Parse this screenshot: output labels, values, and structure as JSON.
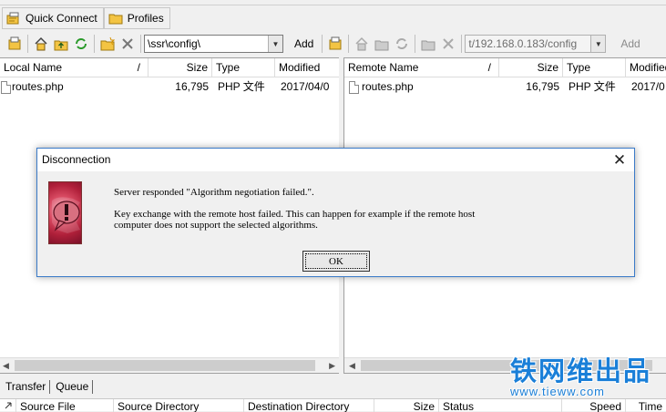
{
  "quickbar": {
    "quick_connect": "Quick Connect",
    "profiles": "Profiles"
  },
  "local_toolbar": {
    "path": "\\ssr\\config\\",
    "add_label": "Add"
  },
  "remote_toolbar": {
    "path": "t/192.168.0.183/config",
    "add_label": "Add"
  },
  "local_pane": {
    "columns": [
      "Local Name",
      "/",
      "Size",
      "Type",
      "Modified"
    ],
    "rows": [
      {
        "name": "routes.php",
        "size": "16,795",
        "type": "PHP 文件",
        "modified": "2017/04/0"
      }
    ]
  },
  "remote_pane": {
    "columns": [
      "Remote Name",
      "/",
      "Size",
      "Type",
      "Modified"
    ],
    "rows": [
      {
        "name": "routes.php",
        "size": "16,795",
        "type": "PHP 文件",
        "modified": "2017/0"
      }
    ]
  },
  "bottom_tabs": [
    "Transfer",
    "Queue"
  ],
  "queue_columns": [
    "Source File",
    "Source Directory",
    "Destination Directory",
    "Size",
    "Status",
    "Speed",
    "Time"
  ],
  "dialog": {
    "title": "Disconnection",
    "line1": "Server responded \"Algorithm negotiation failed.\".",
    "line2": "Key exchange with the remote host failed. This can happen for example if the remote host",
    "line3": "computer does not support the selected algorithms.",
    "ok_label": "OK"
  },
  "watermark": {
    "text": "铁网维出品",
    "url": "www.tieww.com"
  },
  "icons": [
    "quick-connect-icon",
    "profiles-folder-icon",
    "close-icon",
    "error-icon"
  ],
  "colors": {
    "dialog_border": "#3a7ac8",
    "watermark": "#1a7fd8",
    "error_icon": "#c0304a"
  }
}
